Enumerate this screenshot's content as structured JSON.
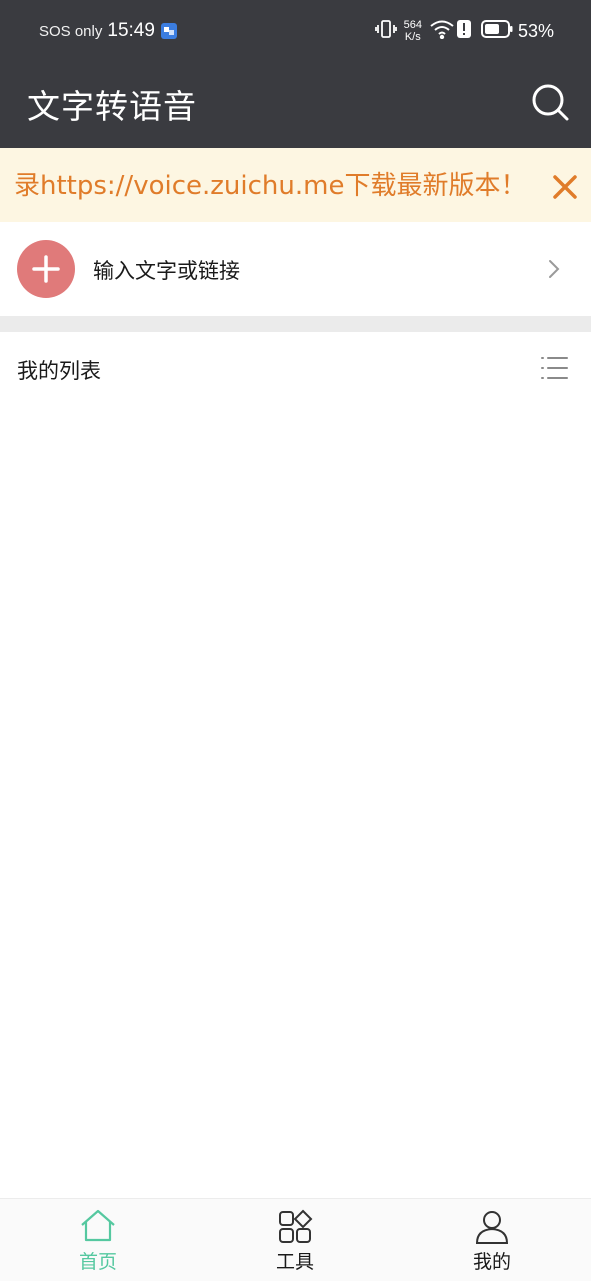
{
  "status_bar": {
    "carrier": "SOS only",
    "time": "15:49",
    "net_speed_value": "564",
    "net_speed_unit": "K/s",
    "battery_percent": "53%",
    "battery_level": 0.53
  },
  "header": {
    "title": "文字转语音",
    "search_icon": "search-icon"
  },
  "banner": {
    "text": "录https://voice.zuichu.me下载最新版本！",
    "close_icon": "close-icon"
  },
  "input": {
    "label": "输入文字或链接",
    "add_icon": "plus-icon",
    "chevron_icon": "chevron-right-icon"
  },
  "list": {
    "title": "我的列表",
    "menu_icon": "list-menu-icon",
    "items": []
  },
  "bottom_nav": {
    "items": [
      {
        "label": "首页",
        "icon": "home-icon",
        "active": true
      },
      {
        "label": "工具",
        "icon": "tools-icon",
        "active": false
      },
      {
        "label": "我的",
        "icon": "user-icon",
        "active": false
      }
    ]
  },
  "colors": {
    "header_bg": "#3a3b40",
    "banner_bg": "#fdf6e2",
    "banner_text": "#e07c2a",
    "add_button": "#e07a7a",
    "active_tab": "#55c8a0"
  }
}
